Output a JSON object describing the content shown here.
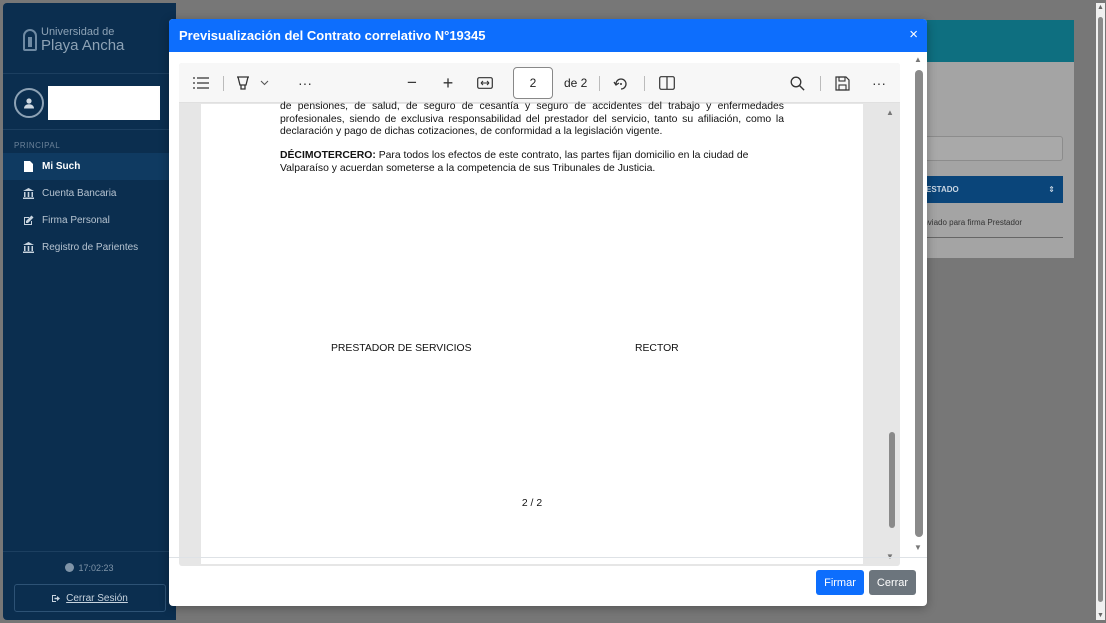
{
  "sidebar": {
    "logo_line1": "Universidad de",
    "logo_line2": "Playa Ancha",
    "section_label": "PRINCIPAL",
    "items": [
      {
        "label": "Mi Such",
        "active": true
      },
      {
        "label": "Cuenta Bancaria"
      },
      {
        "label": "Firma Personal"
      },
      {
        "label": "Registro de Parientes"
      }
    ],
    "clock": "17:02:23",
    "logout_label": "Cerrar Sesión"
  },
  "background": {
    "status_label": "ESTADO",
    "note": "Enviado para firma Prestador"
  },
  "modal": {
    "title": "Previsualización del Contrato correlativo N°19345",
    "close_symbol": "×",
    "buttons": {
      "sign": "Firmar",
      "close": "Cerrar"
    }
  },
  "pdf_toolbar": {
    "current_page": "2",
    "total_pages": "de 2",
    "zoom_out_symbol": "−",
    "zoom_in_symbol": "+",
    "more_symbol": "···"
  },
  "document": {
    "paragraph1": "de pensiones, de salud, de seguro de cesantía y seguro de accidentes del trabajo y enfermedades profesionales, siendo de exclusiva responsabilidad del prestador del servicio, tanto su afiliación, como la declaración y pago de dichas cotizaciones, de conformidad a la legislación vigente.",
    "clause_heading": "DÉCIMOTERCERO:",
    "clause_text": "Para todos los efectos de este contrato, las partes fijan domicilio en la ciudad de Valparaíso y acuerdan someterse a la competencia de sus Tribunales de Justicia.",
    "signature_left": "PRESTADOR DE SERVICIOS",
    "signature_right": "RECTOR",
    "page_number": "2 / 2"
  }
}
